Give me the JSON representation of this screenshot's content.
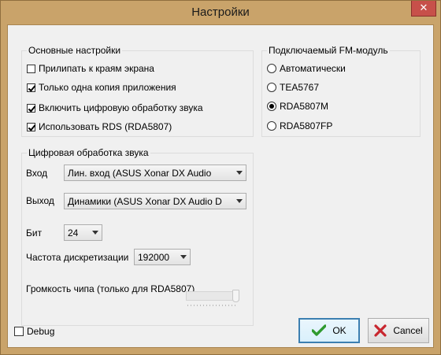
{
  "window": {
    "title": "Настройки",
    "close_glyph": "✕"
  },
  "general": {
    "title": "Основные настройки",
    "items": [
      {
        "label": "Прилипать к краям экрана",
        "checked": false
      },
      {
        "label": "Только одна копия приложения",
        "checked": true
      },
      {
        "label": "Включить цифровую обработку звука",
        "checked": true
      },
      {
        "label": "Использовать RDS (RDA5807)",
        "checked": true
      }
    ]
  },
  "fm_module": {
    "title": "Подключаемый FM-модуль",
    "options": [
      {
        "label": "Автоматически",
        "selected": false
      },
      {
        "label": "TEA5767",
        "selected": false
      },
      {
        "label": "RDA5807M",
        "selected": true
      },
      {
        "label": "RDA5807FP",
        "selected": false
      }
    ]
  },
  "dsp": {
    "title": "Цифровая обработка звука",
    "input_label": "Вход",
    "input_value": "Лин. вход (ASUS Xonar DX Audio",
    "output_label": "Выход",
    "output_value": "Динамики (ASUS Xonar DX Audio D",
    "bits_label": "Бит",
    "bits_value": "24",
    "rate_label": "Частота дискретизации",
    "rate_value": "192000",
    "volume_label": "Громкость чипа (только для RDA5807)",
    "volume_level": 1.0
  },
  "debug": {
    "label": "Debug",
    "checked": false
  },
  "buttons": {
    "ok": "OK",
    "cancel": "Cancel"
  },
  "colors": {
    "frame": "#c9a36a",
    "close": "#c7504a",
    "ok_check": "#2f9a2f",
    "cancel_x": "#c8262e"
  }
}
